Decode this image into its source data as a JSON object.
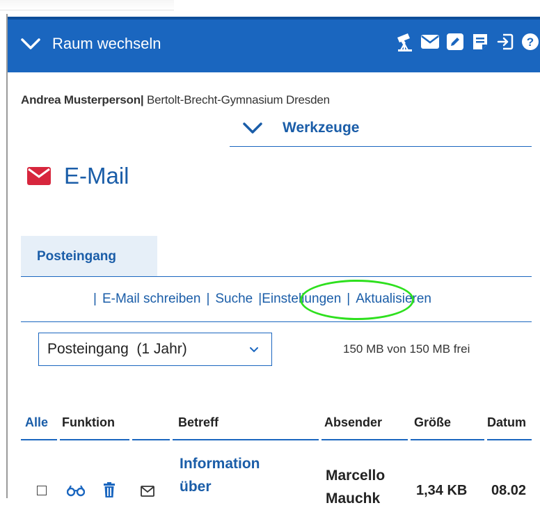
{
  "topbar": {
    "room_switch_label": "Raum wechseln",
    "icons": [
      "telescope-icon",
      "mail-icon",
      "edit-icon",
      "notes-icon",
      "logout-icon",
      "help-icon"
    ],
    "color": "#1a66bf"
  },
  "user": {
    "name": "Andrea Musterperson",
    "separator": "|",
    "school": "Bertolt-Brecht-Gymnasium Dresden"
  },
  "tools": {
    "label": "Werkzeuge"
  },
  "page": {
    "title": "E-Mail",
    "icon": "mail-icon",
    "icon_color": "#d7263d"
  },
  "tabs": [
    {
      "label": "Posteingang",
      "active": true
    }
  ],
  "actions": {
    "items": [
      {
        "label": "E-Mail schreiben"
      },
      {
        "label": "Suche"
      },
      {
        "label": "Einstellungen",
        "highlighted": true
      },
      {
        "label": "Aktualisieren"
      }
    ],
    "separator": "|"
  },
  "folder_select": {
    "value": "Posteingang  (1 Jahr)"
  },
  "quota": {
    "text": "150 MB von 150 MB frei"
  },
  "table": {
    "headers": {
      "all": "Alle",
      "function": "Funktion",
      "subject": "Betreff",
      "sender": "Absender",
      "size": "Größe",
      "date": "Datum"
    },
    "rows": [
      {
        "subject_line1": "Information",
        "subject_line2": "über",
        "sender_line1": "Marcello",
        "sender_line2": "Mauchk",
        "size": "1,34 KB",
        "date": "08.02"
      }
    ]
  }
}
